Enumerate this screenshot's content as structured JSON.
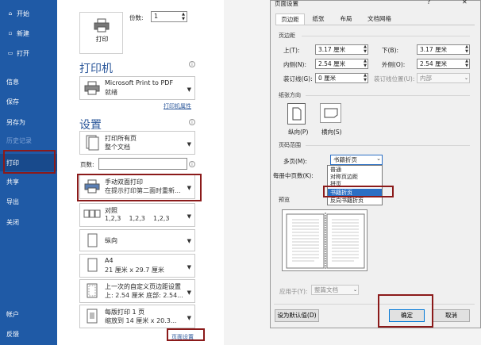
{
  "sidebar": {
    "items": [
      {
        "label": "开始",
        "icon": "home-icon"
      },
      {
        "label": "新建",
        "icon": "new-doc-icon"
      },
      {
        "label": "打开",
        "icon": "folder-open-icon"
      },
      {
        "label": "信息"
      },
      {
        "label": "保存"
      },
      {
        "label": "另存为"
      },
      {
        "label": "历史记录"
      },
      {
        "label": "打印"
      },
      {
        "label": "共享"
      },
      {
        "label": "导出"
      },
      {
        "label": "关闭"
      },
      {
        "label": "帐户"
      },
      {
        "label": "反馈"
      }
    ]
  },
  "print": {
    "print_button_label": "打印",
    "copies_label": "份数:",
    "copies_value": "1",
    "printer_heading": "打印机",
    "printer_name": "Microsoft Print to PDF",
    "printer_status": "就绪",
    "printer_properties": "打印机属性",
    "settings_heading": "设置",
    "pages_label": "页数:",
    "pages_value": "",
    "page_setup_link": "页面设置",
    "options": [
      {
        "line1": "打印所有页",
        "line2": "整个文档"
      },
      {
        "line1": "手动双面打印",
        "line2": "在提示打印第二面时重新..."
      },
      {
        "line1": "对照",
        "line2": "1,2,3    1,2,3    1,2,3"
      },
      {
        "line1": "纵向",
        "line2": ""
      },
      {
        "line1": "A4",
        "line2": "21 厘米 x 29.7 厘米"
      },
      {
        "line1": "上一次的自定义页边距设置",
        "line2": "上: 2.54 厘米 底部: 2.54..."
      },
      {
        "line1": "每版打印 1 页",
        "line2": "缩放到 14 厘米 x 20.3..."
      }
    ]
  },
  "dialog": {
    "title": "页面设置",
    "help": "?",
    "close": "✕",
    "tabs": [
      "页边距",
      "纸张",
      "布局",
      "文档网格"
    ],
    "margins_section": "页边距",
    "top_label": "上(T):",
    "top_value": "3.17 厘米",
    "bottom_label": "下(B):",
    "bottom_value": "3.17 厘米",
    "inside_label": "内侧(N):",
    "inside_value": "2.54 厘米",
    "outside_label": "外侧(O):",
    "outside_value": "2.54 厘米",
    "gutter_label": "装订线(G):",
    "gutter_value": "0 厘米",
    "gutter_pos_label": "装订线位置(U):",
    "gutter_pos_value": "内部",
    "orientation_section": "纸张方向",
    "portrait_label": "纵向(P)",
    "landscape_label": "横向(S)",
    "pages_section": "页码范围",
    "multiple_pages_label": "多页(M):",
    "multiple_pages_value": "书籍折页",
    "sheets_per_booklet_label": "每册中页数(K):",
    "dropdown_options": [
      "普通",
      "对称页边距",
      "拼页",
      "书籍折页",
      "反向书籍折页"
    ],
    "selected_option_index": 3,
    "preview_section": "预览",
    "apply_to_label": "应用于(Y):",
    "apply_to_value": "整篇文档",
    "set_default": "设为默认值(D)",
    "ok": "确定",
    "cancel": "取消"
  }
}
